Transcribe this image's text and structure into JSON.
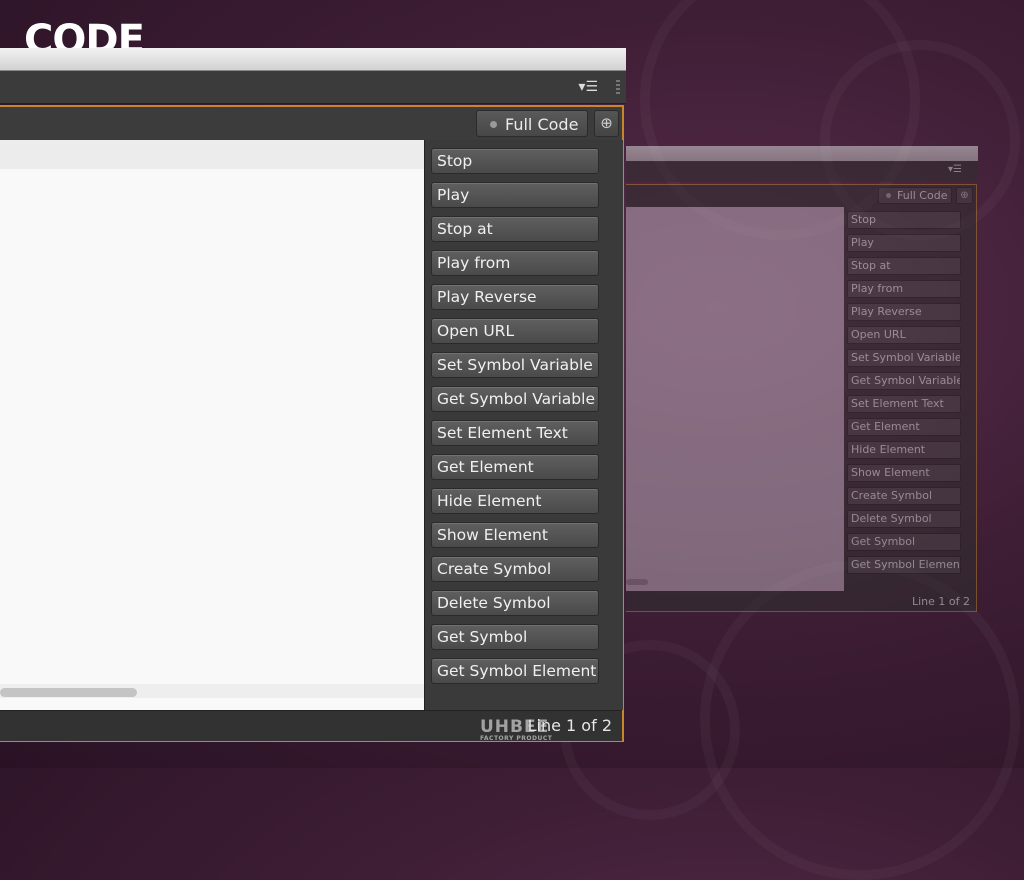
{
  "heading": "CODE",
  "main_panel": {
    "menu_icon": "panel-menu-icon",
    "toolbar": {
      "full_code_label": "Full Code",
      "pin_icon": "pin-icon"
    },
    "snippets": [
      "Stop",
      "Play",
      "Stop at",
      "Play from",
      "Play Reverse",
      "Open URL",
      "Set Symbol Variable",
      "Get Symbol Variable",
      "Set Element Text",
      "Get Element",
      "Hide Element",
      "Show Element",
      "Create Symbol",
      "Delete Symbol",
      "Get Symbol",
      "Get Symbol Element"
    ],
    "status": "Line 1 of 2",
    "watermark": {
      "brand": "UHBEE",
      "tagline": "FACTORY PRODUCT"
    }
  },
  "ghost_panel": {
    "toolbar": {
      "full_code_label": "Full Code"
    },
    "snippets": [
      "Stop",
      "Play",
      "Stop at",
      "Play from",
      "Play Reverse",
      "Open URL",
      "Set Symbol Variable",
      "Get Symbol Variable",
      "Set Element Text",
      "Get Element",
      "Hide Element",
      "Show Element",
      "Create Symbol",
      "Delete Symbol",
      "Get Symbol",
      "Get Symbol Element"
    ],
    "status": "Line 1 of 2"
  },
  "colors": {
    "frame_accent": "#c4882b",
    "background": "#3e1e35"
  }
}
